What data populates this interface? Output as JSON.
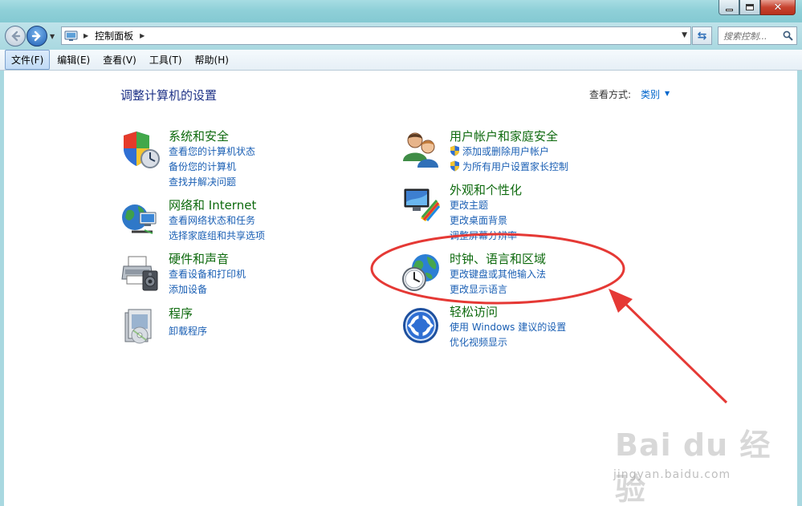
{
  "window": {
    "close_glyph": "✕"
  },
  "nav": {
    "address_path": "控制面板",
    "search_placeholder": "搜索控制...",
    "back_icon": "back-arrow",
    "forward_icon": "forward-arrow"
  },
  "menu": {
    "items": [
      {
        "label": "文件(F)",
        "active": true
      },
      {
        "label": "编辑(E)",
        "active": false
      },
      {
        "label": "查看(V)",
        "active": false
      },
      {
        "label": "工具(T)",
        "active": false
      },
      {
        "label": "帮助(H)",
        "active": false
      }
    ]
  },
  "main": {
    "title": "调整计算机的设置",
    "view_by_label": "查看方式:",
    "view_by_value": "类别"
  },
  "categories": [
    {
      "title": "系统和安全",
      "icon": "shield-icon",
      "links": [
        "查看您的计算机状态",
        "备份您的计算机",
        "查找并解决问题"
      ]
    },
    {
      "title": "网络和 Internet",
      "icon": "network-globe-icon",
      "links": [
        "查看网络状态和任务",
        "选择家庭组和共享选项"
      ]
    },
    {
      "title": "硬件和声音",
      "icon": "printer-icon",
      "links": [
        "查看设备和打印机",
        "添加设备"
      ]
    },
    {
      "title": "程序",
      "icon": "programs-icon",
      "links": [
        "卸载程序"
      ]
    },
    {
      "title": "用户帐户和家庭安全",
      "icon": "users-icon",
      "links": [
        "添加或删除用户帐户",
        "为所有用户设置家长控制"
      ]
    },
    {
      "title": "外观和个性化",
      "icon": "monitor-palette-icon",
      "links": [
        "更改主题",
        "更改桌面背景",
        "调整屏幕分辨率"
      ]
    },
    {
      "title": "时钟、语言和区域",
      "icon": "clock-globe-icon",
      "links": [
        "更改键盘或其他输入法",
        "更改显示语言"
      ]
    },
    {
      "title": "轻松访问",
      "icon": "ease-of-access-icon",
      "links": [
        "使用 Windows 建议的设置",
        "优化视频显示"
      ]
    }
  ],
  "annotation": {
    "color": "#e53935"
  },
  "watermark": {
    "main": "Bai du 经验",
    "sub": "jingyan.baidu.com"
  }
}
